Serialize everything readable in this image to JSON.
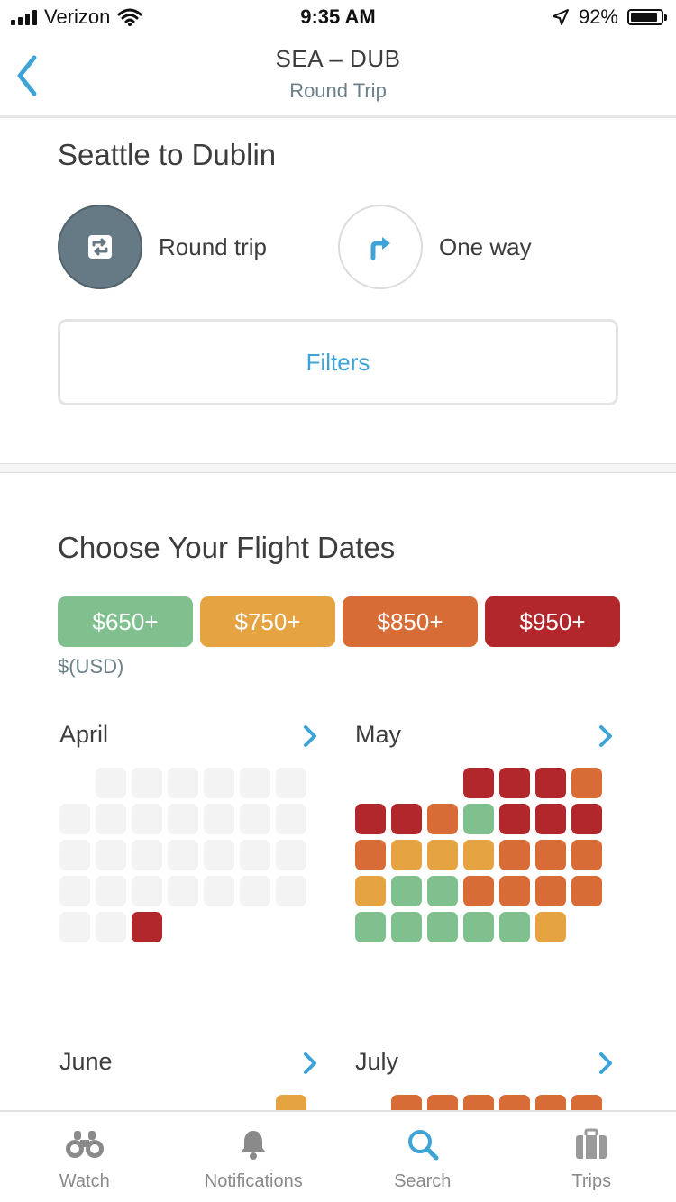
{
  "status": {
    "carrier": "Verizon",
    "time": "9:35 AM",
    "battery": "92%",
    "battery_level": 0.92
  },
  "nav": {
    "title": "SEA – DUB",
    "subtitle": "Round Trip"
  },
  "route": {
    "title": "Seattle to Dublin",
    "round_trip_label": "Round trip",
    "one_way_label": "One way",
    "selected": "round-trip",
    "filters_label": "Filters"
  },
  "dates": {
    "title": "Choose Your Flight Dates",
    "legend": [
      {
        "label": "$650+",
        "color": "#80c08f"
      },
      {
        "label": "$750+",
        "color": "#e5a341"
      },
      {
        "label": "$850+",
        "color": "#d86c37"
      },
      {
        "label": "$950+",
        "color": "#b2272b"
      }
    ],
    "currency": "$(USD)",
    "empty_color": "#f3f3f3",
    "months": [
      {
        "name": "April",
        "cells": [
          "",
          "e",
          "e",
          "e",
          "e",
          "e",
          "e",
          "e",
          "e",
          "e",
          "e",
          "e",
          "e",
          "e",
          "e",
          "e",
          "e",
          "e",
          "e",
          "e",
          "e",
          "e",
          "e",
          "e",
          "e",
          "e",
          "e",
          "e",
          "e",
          "e",
          "r"
        ]
      },
      {
        "name": "May",
        "cells": [
          "",
          "",
          "",
          "r",
          "r",
          "r",
          "o",
          "r",
          "r",
          "o",
          "g",
          "r",
          "r",
          "r",
          "o",
          "y",
          "y",
          "y",
          "o",
          "o",
          "o",
          "y",
          "g",
          "g",
          "o",
          "o",
          "o",
          "o",
          "g",
          "g",
          "g",
          "g",
          "g",
          "y"
        ]
      },
      {
        "name": "June",
        "cells": [
          "",
          "",
          "",
          "",
          "",
          "",
          "y"
        ]
      },
      {
        "name": "July",
        "cells": [
          "",
          "o",
          "o",
          "o",
          "o",
          "o",
          "o"
        ]
      }
    ],
    "price_colors": {
      "g": "#80c08f",
      "y": "#e5a341",
      "o": "#d86c37",
      "r": "#b2272b",
      "e": "#f3f3f3"
    }
  },
  "tabs": [
    {
      "label": "Watch",
      "icon": "binoculars-icon",
      "active": false
    },
    {
      "label": "Notifications",
      "icon": "bell-icon",
      "active": false
    },
    {
      "label": "Search",
      "icon": "search-icon",
      "active": true
    },
    {
      "label": "Trips",
      "icon": "suitcase-icon",
      "active": false
    }
  ],
  "colors": {
    "accent": "#3ea4d8",
    "heading": "#3d3d3d",
    "muted": "#6c8088",
    "selected_circle": "#667a85"
  }
}
